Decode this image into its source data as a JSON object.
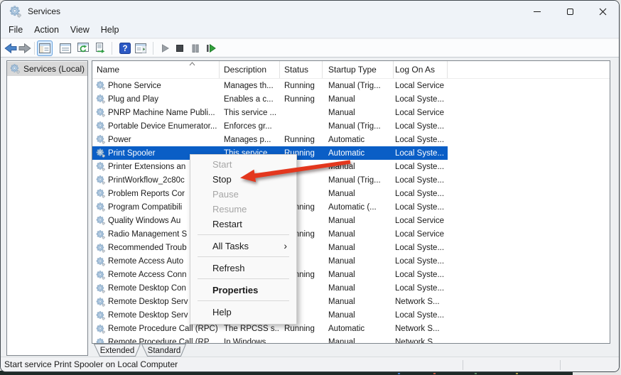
{
  "window": {
    "title": "Services"
  },
  "menubar": {
    "items": [
      {
        "label": "File"
      },
      {
        "label": "Action"
      },
      {
        "label": "View"
      },
      {
        "label": "Help"
      }
    ]
  },
  "toolbar": {
    "icons": [
      "back-icon",
      "forward-icon",
      "show-console-tree-icon",
      "properties-icon",
      "refresh-icon",
      "export-list-icon",
      "help-icon",
      "show-action-pane-icon",
      "start-service-icon",
      "stop-service-icon",
      "pause-service-icon",
      "restart-service-icon"
    ]
  },
  "sidebar": {
    "selected_item": "Services (Local)"
  },
  "table": {
    "columns": [
      "Name",
      "Description",
      "Status",
      "Startup Type",
      "Log On As"
    ],
    "rows": [
      {
        "name": "Phone Service",
        "description": "Manages th...",
        "status": "Running",
        "startup": "Manual (Trig...",
        "logon": "Local Service"
      },
      {
        "name": "Plug and Play",
        "description": "Enables a c...",
        "status": "Running",
        "startup": "Manual",
        "logon": "Local Syste..."
      },
      {
        "name": "PNRP Machine Name Publi...",
        "description": "This service ...",
        "status": "",
        "startup": "Manual",
        "logon": "Local Service"
      },
      {
        "name": "Portable Device Enumerator...",
        "description": "Enforces gr...",
        "status": "",
        "startup": "Manual (Trig...",
        "logon": "Local Syste..."
      },
      {
        "name": "Power",
        "description": "Manages p...",
        "status": "Running",
        "startup": "Automatic",
        "logon": "Local Syste..."
      },
      {
        "name": "Print Spooler",
        "description": "This service...",
        "status": "Running",
        "startup": "Automatic",
        "logon": "Local Syste...",
        "selected": true
      },
      {
        "name": "Printer Extensions an",
        "description": "",
        "status": "",
        "startup": "Manual",
        "logon": "Local Syste..."
      },
      {
        "name": "PrintWorkflow_2c80c",
        "description": "",
        "status": "",
        "startup": "Manual (Trig...",
        "logon": "Local Syste..."
      },
      {
        "name": "Problem Reports Cor",
        "description": "",
        "status": "",
        "startup": "Manual",
        "logon": "Local Syste..."
      },
      {
        "name": "Program Compatibili",
        "description": "",
        "status": "Running",
        "startup": "Automatic (...",
        "logon": "Local Syste..."
      },
      {
        "name": "Quality Windows Au",
        "description": "",
        "status": "",
        "startup": "Manual",
        "logon": "Local Service"
      },
      {
        "name": "Radio Management S",
        "description": "",
        "status": "Running",
        "startup": "Manual",
        "logon": "Local Service"
      },
      {
        "name": "Recommended Troub",
        "description": "",
        "status": "",
        "startup": "Manual",
        "logon": "Local Syste..."
      },
      {
        "name": "Remote Access Auto",
        "description": "",
        "status": "",
        "startup": "Manual",
        "logon": "Local Syste..."
      },
      {
        "name": "Remote Access Conn",
        "description": "",
        "status": "Running",
        "startup": "Manual",
        "logon": "Local Syste..."
      },
      {
        "name": "Remote Desktop Con",
        "description": "",
        "status": "",
        "startup": "Manual",
        "logon": "Local Syste..."
      },
      {
        "name": "Remote Desktop Serv",
        "description": "",
        "status": "",
        "startup": "Manual",
        "logon": "Network S..."
      },
      {
        "name": "Remote Desktop Serv",
        "description": "",
        "status": "",
        "startup": "Manual",
        "logon": "Local Syste..."
      },
      {
        "name": "Remote Procedure Call (RPC)",
        "description": "The RPCSS s...",
        "status": "Running",
        "startup": "Automatic",
        "logon": "Network S..."
      },
      {
        "name": "Remote Procedure Call (RP...",
        "description": "In Windows...",
        "status": "",
        "startup": "Manual",
        "logon": "Network S..."
      }
    ]
  },
  "context_menu": {
    "items": [
      {
        "label": "Start",
        "disabled": true
      },
      {
        "label": "Stop"
      },
      {
        "label": "Pause",
        "disabled": true
      },
      {
        "label": "Resume",
        "disabled": true
      },
      {
        "label": "Restart",
        "separator_after": true
      },
      {
        "label": "All Tasks",
        "submenu": true,
        "separator_after": true
      },
      {
        "label": "Refresh",
        "separator_after": true
      },
      {
        "label": "Properties",
        "bold": true,
        "separator_after": true
      },
      {
        "label": "Help"
      }
    ]
  },
  "tabs": [
    {
      "label": "Extended",
      "selected": true
    },
    {
      "label": "Standard"
    }
  ],
  "statusbar": {
    "text": "Start service Print Spooler on Local Computer"
  },
  "colors": {
    "selection": "#0b62c9",
    "arrow": "#e3371e"
  }
}
